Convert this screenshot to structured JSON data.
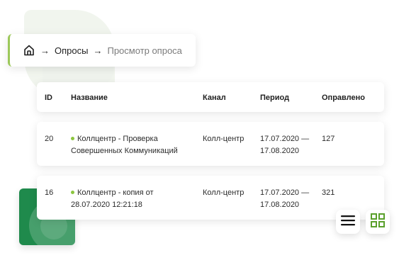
{
  "breadcrumb": {
    "home_icon": "home-icon",
    "separator": "→",
    "items": [
      "Опросы",
      "Просмотр опроса"
    ]
  },
  "table": {
    "columns": [
      "ID",
      "Название",
      "Канал",
      "Период",
      "Оправлено"
    ],
    "rows": [
      {
        "id": "20",
        "name_line1": "Коллцентр - Проверка",
        "name_line2": "Совершенных Коммуникаций",
        "channel": "Колл-центр",
        "period_line1": "17.07.2020 —",
        "period_line2": "17.08.2020",
        "sent": "127"
      },
      {
        "id": "16",
        "name_line1": "Коллцентр - копия от",
        "name_line2": "28.07.2020 12:21:18",
        "channel": "Колл-центр",
        "period_line1": "17.07.2020 —",
        "period_line2": "17.08.2020",
        "sent": "321"
      }
    ]
  },
  "view_toggle": {
    "list_icon": "list-view-icon",
    "grid_icon": "grid-view-icon",
    "grid_color": "#5aa02c"
  },
  "colors": {
    "accent_green": "#8cc63f",
    "brand_green": "#1f8a4c"
  }
}
